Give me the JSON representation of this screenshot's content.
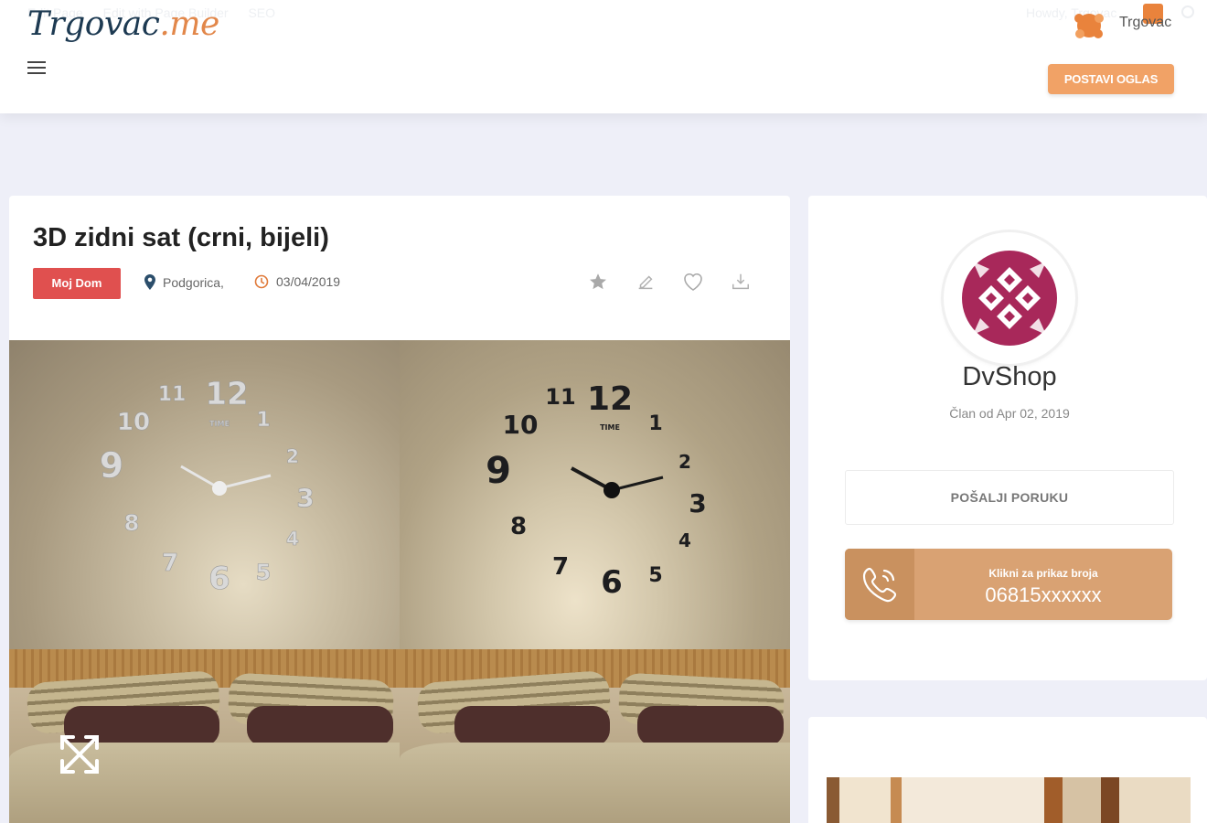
{
  "header": {
    "ghost_links": [
      "Edit Page",
      "Edit with Page Builder",
      "SEO"
    ],
    "ghost_right": "Howdy, Trgovac",
    "logo_main": "Trgovac",
    "logo_tld": ".me",
    "user_name": "Trgovac",
    "post_button_label": "POSTAVI OGLAS",
    "accent_color": "#f1a266"
  },
  "listing": {
    "title": "3D zidni sat (crni, bijeli)",
    "category": "Moj Dom",
    "location": "Podgorica,",
    "date": "03/04/2019",
    "actions": [
      "star-icon",
      "edit-icon",
      "heart-icon",
      "download-icon"
    ],
    "category_color": "#e0504f"
  },
  "gallery": {
    "clock_numbers": [
      "12",
      "11",
      "10",
      "9",
      "8",
      "7",
      "6",
      "5",
      "4",
      "3",
      "2",
      "1"
    ],
    "clock_word": "TIME"
  },
  "seller": {
    "name": "DvShop",
    "member_since": "Član od Apr 02, 2019",
    "message_button": "POŠALJI PORUKU",
    "phone_hint": "Klikni za prikaz broja",
    "phone_number": "06815xxxxxx",
    "phone_color": "#d9a273",
    "logo_color": "#a8285a"
  }
}
